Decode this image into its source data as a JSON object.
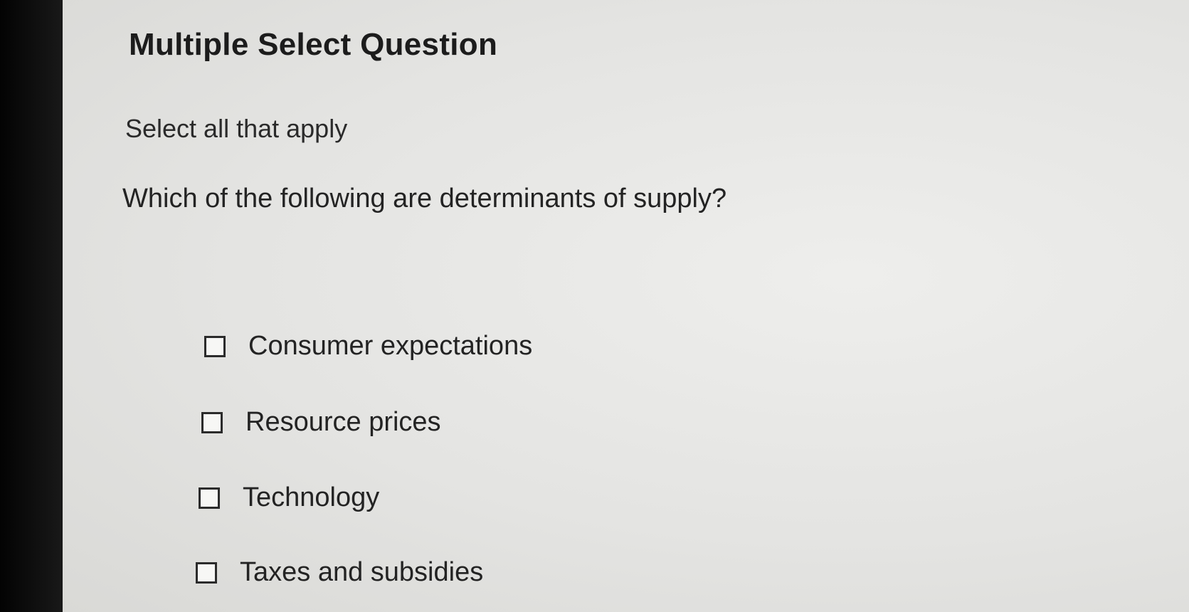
{
  "question": {
    "title": "Multiple Select Question",
    "instruction": "Select all that apply",
    "prompt": "Which of the following are determinants of supply?",
    "options": [
      {
        "label": "Consumer expectations",
        "checked": false
      },
      {
        "label": "Resource prices",
        "checked": false
      },
      {
        "label": "Technology",
        "checked": false
      },
      {
        "label": "Taxes and subsidies",
        "checked": false
      }
    ]
  },
  "colors": {
    "page_background": "#e6e6e4",
    "text": "#1f1f1f",
    "checkbox_border": "#2b2b2b"
  }
}
